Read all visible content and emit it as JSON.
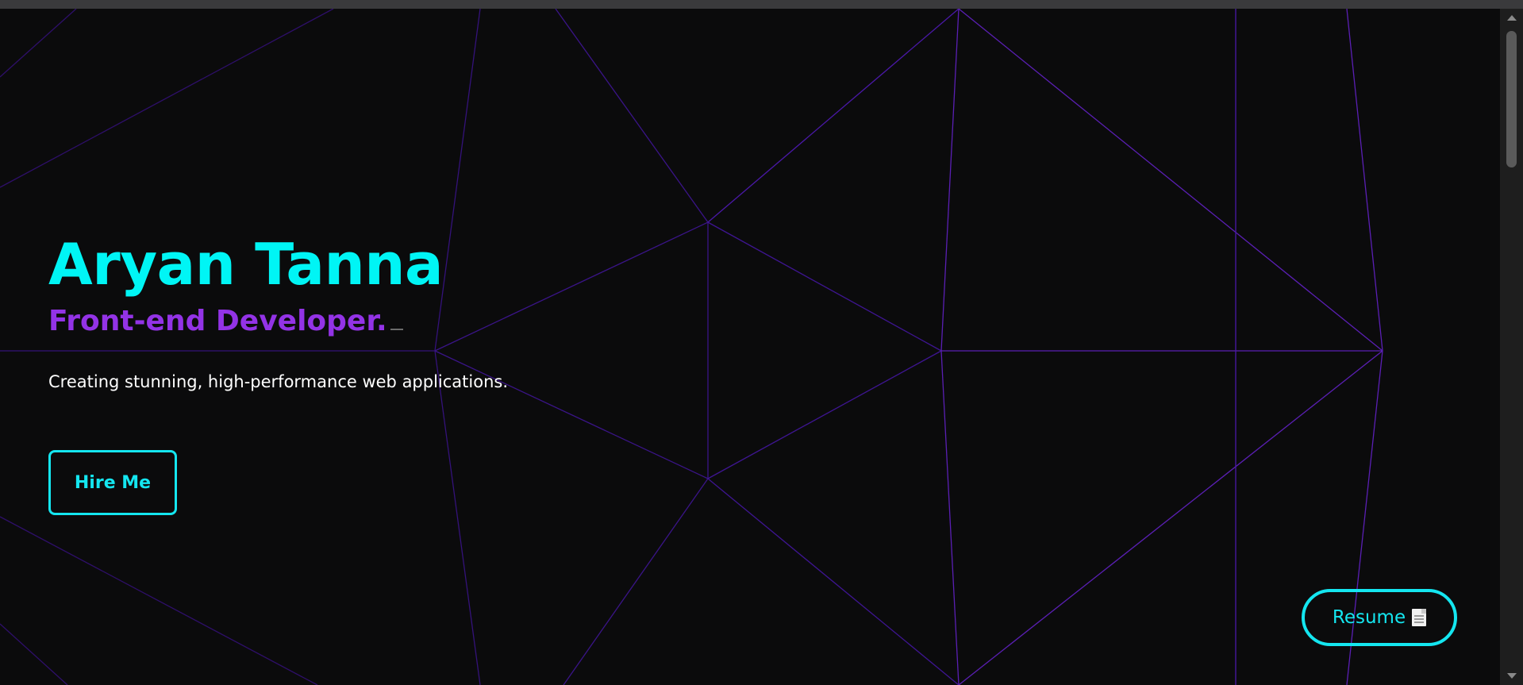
{
  "hero": {
    "name": "Aryan Tanna",
    "role": "Front-end Developer.",
    "tagline": "Creating stunning, high-performance web applications."
  },
  "actions": {
    "hire_label": "Hire Me",
    "resume_label": "Resume"
  },
  "icons": {
    "resume": "document-icon",
    "scroll_up": "chevron-up-icon",
    "scroll_down": "chevron-down-icon"
  },
  "colors": {
    "background": "#0b0b0c",
    "accent_cyan": "#00f5f5",
    "accent_purple": "#9333e6",
    "mesh_line": "#5a1fb4",
    "text": "#ffffff"
  },
  "scrollbar": {
    "position": 0.0
  }
}
